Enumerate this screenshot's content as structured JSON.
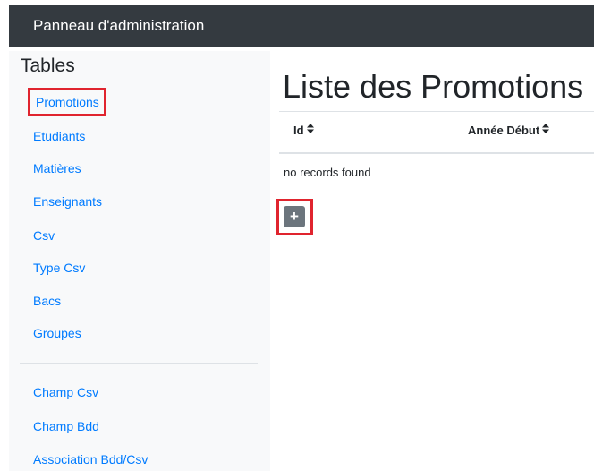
{
  "navbar": {
    "brand": "Panneau d'administration"
  },
  "sidebar": {
    "heading": "Tables",
    "items": [
      {
        "label": "Promotions",
        "selected": true
      },
      {
        "label": "Etudiants"
      },
      {
        "label": "Matières"
      },
      {
        "label": "Enseignants"
      },
      {
        "label": "Csv"
      },
      {
        "label": "Type Csv"
      },
      {
        "label": "Bacs"
      },
      {
        "label": "Groupes"
      }
    ],
    "secondary_items": [
      {
        "label": "Champ Csv"
      },
      {
        "label": "Champ Bdd"
      },
      {
        "label": "Association Bdd/Csv"
      }
    ]
  },
  "main": {
    "title": "Liste des Promotions",
    "table": {
      "columns": [
        {
          "label": "Id"
        },
        {
          "label": "Année Début"
        }
      ],
      "empty_message": "no records found"
    },
    "add_button": {
      "label": "+"
    }
  },
  "colors": {
    "navbar": "#343a40",
    "link": "#007bff",
    "sidebar_bg": "#f8f9fa",
    "button": "#6c757d",
    "highlight": "#e0242e"
  },
  "icons": {
    "sort": "sort-icon"
  }
}
